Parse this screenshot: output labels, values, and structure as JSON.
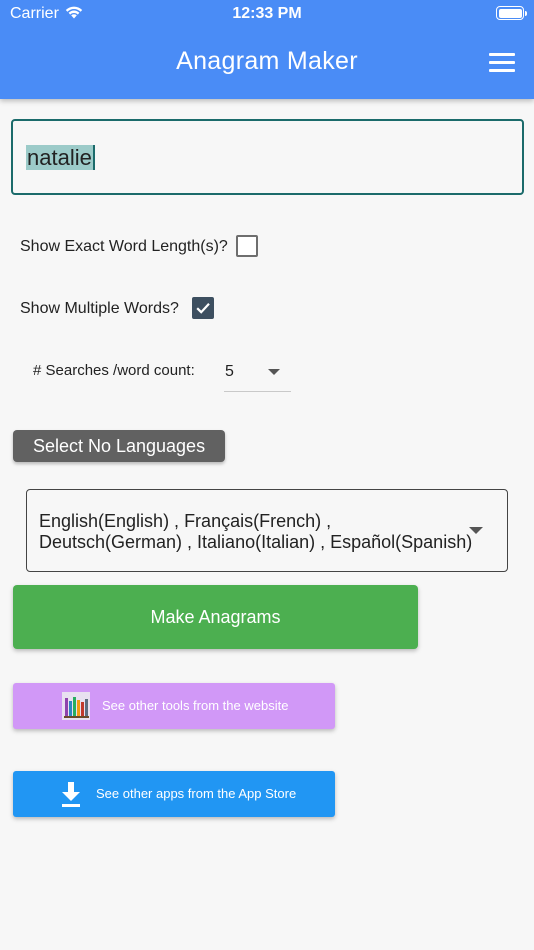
{
  "status_bar": {
    "carrier": "Carrier",
    "time": "12:33 PM"
  },
  "app_bar": {
    "title": "Anagram Maker"
  },
  "word_input": {
    "value": "natalie"
  },
  "options": {
    "exact_length_label": "Show Exact Word Length(s)?",
    "exact_length_checked": false,
    "multiple_words_label": "Show Multiple Words?",
    "multiple_words_checked": true,
    "search_count_label": "# Searches /word count:",
    "search_count_value": "5"
  },
  "select_languages_button": "Select No Languages",
  "languages": {
    "line1": "English(English) , Français(French) ,",
    "line2": "Deutsch(German) , Italiano(Italian) , Español(Spanish)"
  },
  "make_anagrams_button": "Make Anagrams",
  "website_button": "See other tools from the website",
  "appstore_button": "See other apps from the App Store",
  "colors": {
    "app_bar": "#4a8cf6",
    "make_button": "#4caf50",
    "website_button": "#d198f7",
    "appstore_button": "#2196f3",
    "checkbox_checked": "#3d4f60"
  }
}
